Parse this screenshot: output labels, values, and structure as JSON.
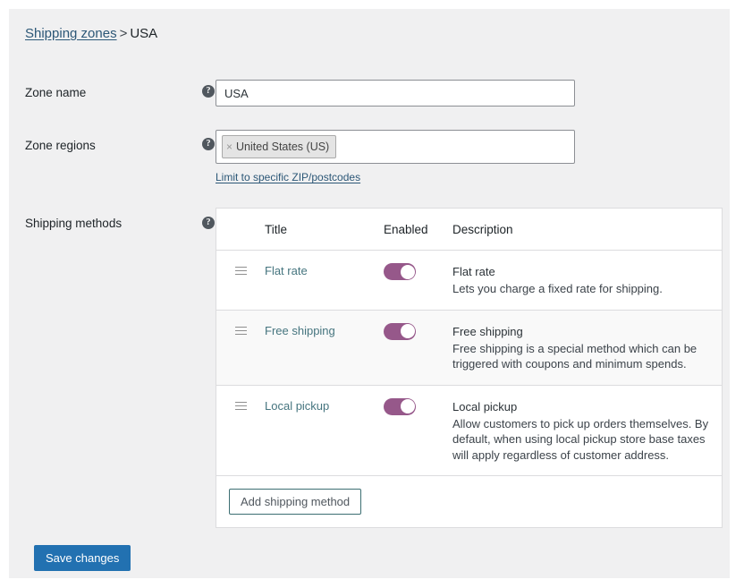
{
  "breadcrumb": {
    "parent_label": "Shipping zones",
    "separator": ">",
    "current_label": "USA"
  },
  "fields": {
    "zone_name": {
      "label": "Zone name",
      "value": "USA",
      "placeholder": "Zone name",
      "help": "?"
    },
    "zone_regions": {
      "label": "Zone regions",
      "help": "?",
      "chips": [
        {
          "remove_icon": "×",
          "label": "United States (US)"
        }
      ],
      "postcode_link": "Limit to specific ZIP/postcodes"
    },
    "shipping_methods": {
      "label": "Shipping methods",
      "help": "?"
    }
  },
  "methods_table": {
    "columns": {
      "title": "Title",
      "enabled": "Enabled",
      "description": "Description"
    },
    "rows": [
      {
        "title": "Flat rate",
        "enabled": true,
        "desc_title": "Flat rate",
        "desc_text": "Lets you charge a fixed rate for shipping."
      },
      {
        "title": "Free shipping",
        "enabled": true,
        "desc_title": "Free shipping",
        "desc_text": "Free shipping is a special method which can be triggered with coupons and minimum spends."
      },
      {
        "title": "Local pickup",
        "enabled": true,
        "desc_title": "Local pickup",
        "desc_text": "Allow customers to pick up orders themselves. By default, when using local pickup store base taxes will apply regardless of customer address."
      }
    ],
    "add_method_label": "Add shipping method"
  },
  "actions": {
    "save_label": "Save changes"
  },
  "colors": {
    "panel_bg": "#f0f0f1",
    "toggle_on": "#96588a",
    "save_button": "#2271b1",
    "link": "#2c5777",
    "method_link": "#46757f"
  }
}
